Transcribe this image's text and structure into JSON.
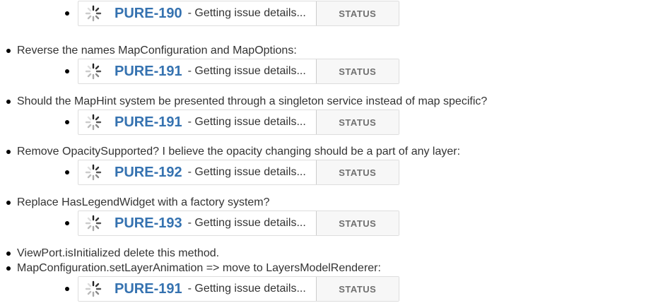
{
  "items": [
    {
      "type": "jira",
      "key": "PURE-190",
      "separator": "-",
      "summary": "Getting issue details...",
      "status": "STATUS"
    },
    {
      "type": "text",
      "text": "Reverse the names MapConfiguration and MapOptions:"
    },
    {
      "type": "jira",
      "key": "PURE-191",
      "separator": "-",
      "summary": "Getting issue details...",
      "status": "STATUS"
    },
    {
      "type": "text",
      "text": "Should the MapHint system be presented through a singleton service instead of map specific?"
    },
    {
      "type": "jira",
      "key": "PURE-191",
      "separator": "-",
      "summary": "Getting issue details...",
      "status": "STATUS"
    },
    {
      "type": "text",
      "text": "Remove OpacitySupported? I believe the opacity changing should be a part of any layer:"
    },
    {
      "type": "jira",
      "key": "PURE-192",
      "separator": "-",
      "summary": "Getting issue details...",
      "status": "STATUS"
    },
    {
      "type": "text",
      "text": "Replace HasLegendWidget with a factory system?"
    },
    {
      "type": "jira",
      "key": "PURE-193",
      "separator": "-",
      "summary": "Getting issue details...",
      "status": "STATUS"
    },
    {
      "type": "text",
      "text": "ViewPort.isInitialized delete this method."
    },
    {
      "type": "text",
      "text": "MapConfiguration.setLayerAnimation => move to LayersModelRenderer:"
    },
    {
      "type": "jira",
      "key": "PURE-191",
      "separator": "-",
      "summary": "Getting issue details...",
      "status": "STATUS"
    }
  ],
  "colors": {
    "link": "#3572b0",
    "text": "#333333",
    "status_text": "#707070"
  },
  "icons": {
    "loading": "loading-spinner-icon"
  }
}
